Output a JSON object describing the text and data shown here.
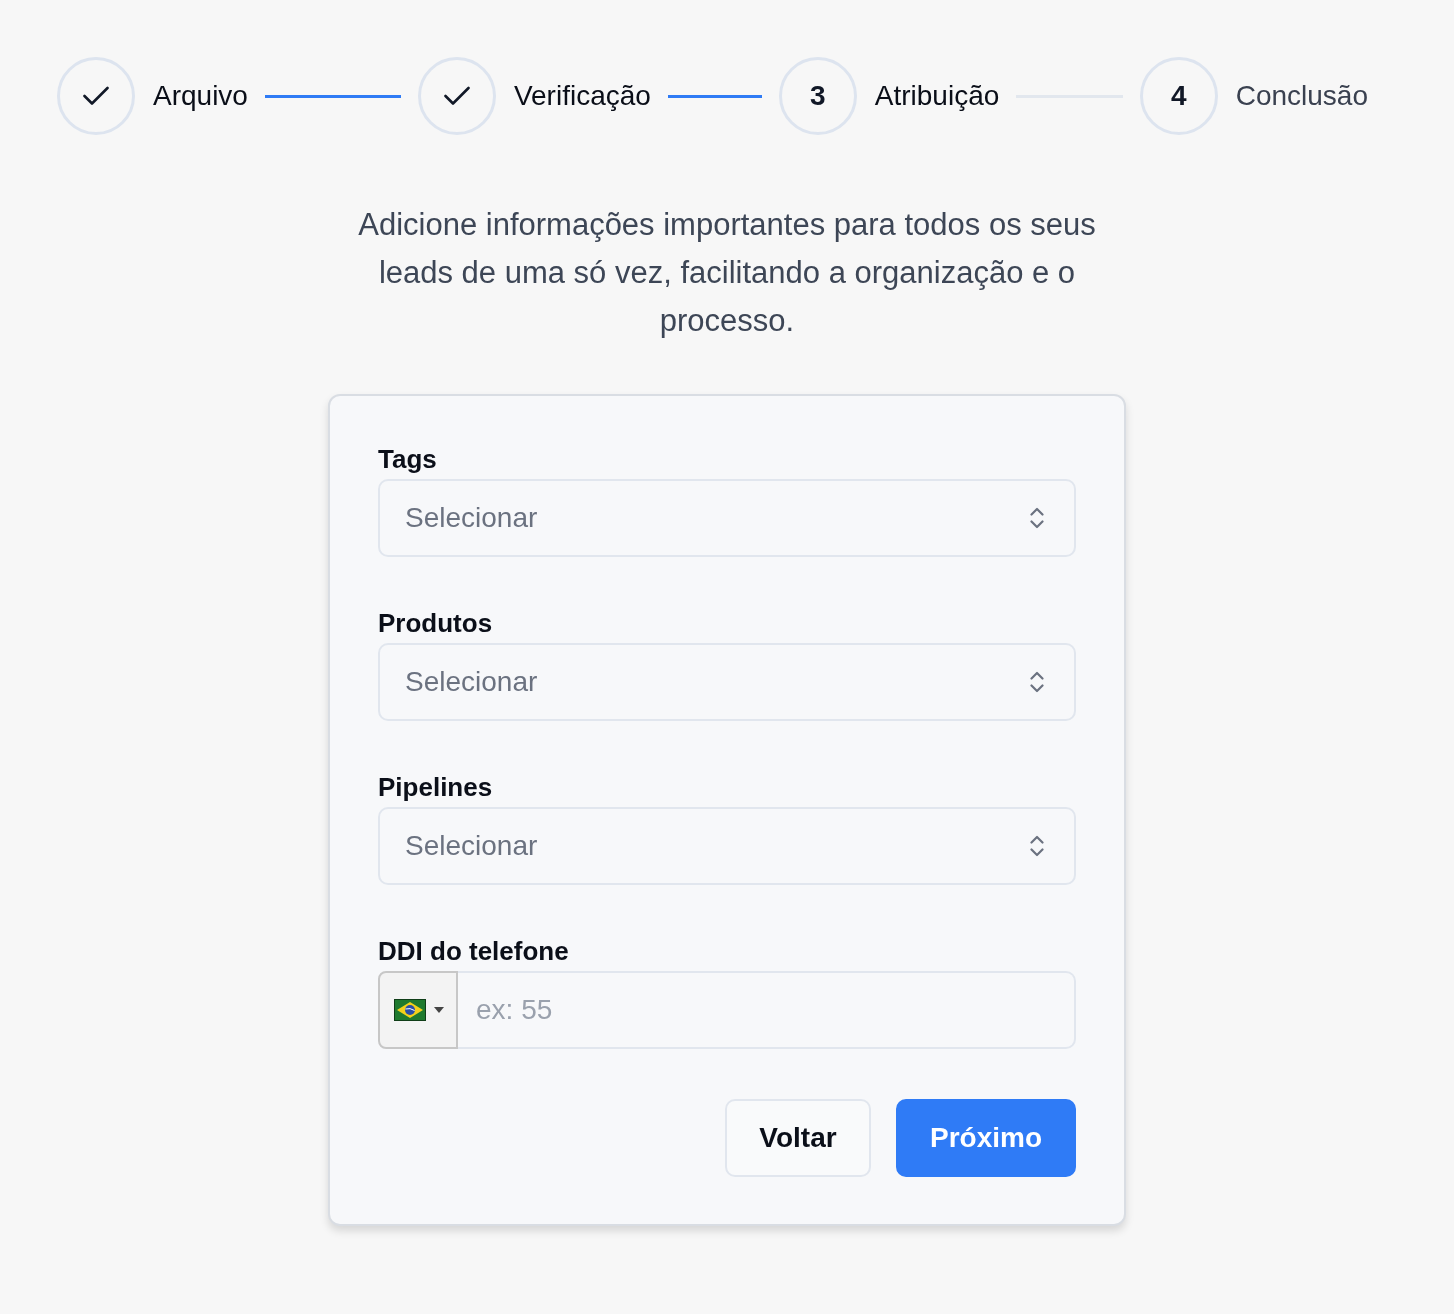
{
  "stepper": {
    "steps": [
      {
        "label": "Arquivo",
        "completed": true,
        "upcoming": false
      },
      {
        "label": "Verificação",
        "completed": true,
        "upcoming": false
      },
      {
        "label": "Atribuição",
        "completed": false,
        "upcoming": false,
        "number": "3"
      },
      {
        "label": "Conclusão",
        "completed": false,
        "upcoming": true,
        "number": "4"
      }
    ]
  },
  "description": "Adicione informações importantes para todos os seus leads de uma só vez, facilitando a organização e o processo.",
  "form": {
    "fields": [
      {
        "kind": "select",
        "label": "Tags",
        "placeholder": "Selecionar"
      },
      {
        "kind": "select",
        "label": "Produtos",
        "placeholder": "Selecionar"
      },
      {
        "kind": "select",
        "label": "Pipelines",
        "placeholder": "Selecionar"
      },
      {
        "kind": "phone",
        "label": "DDI do telefone",
        "placeholder": "ex: 55"
      }
    ],
    "buttons": [
      {
        "kind": "secondary",
        "label": "Voltar"
      },
      {
        "kind": "primary",
        "label": "Próximo"
      }
    ]
  }
}
